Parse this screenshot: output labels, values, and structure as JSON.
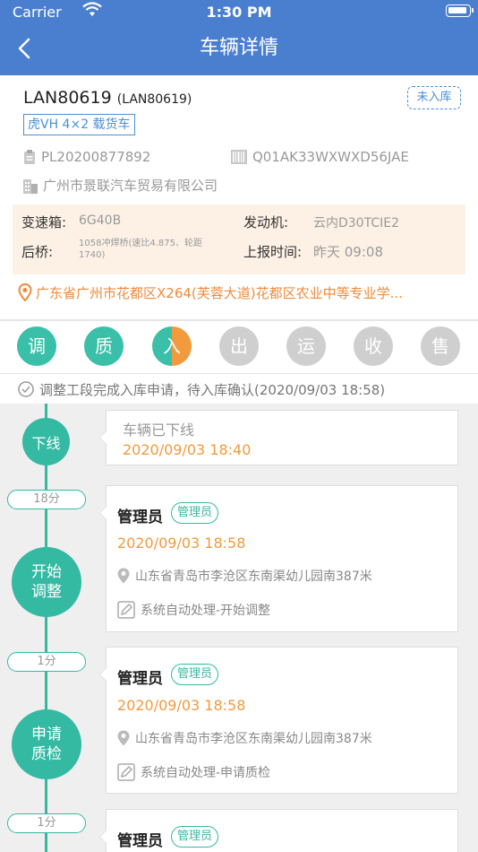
{
  "status_bar": {
    "carrier": "Carrier",
    "time": "1:30 PM"
  },
  "nav": {
    "title": "车辆详情"
  },
  "vehicle": {
    "plate": "LAN80619",
    "plate_sub": "(LAN80619)",
    "status": "未入库",
    "model": "虎VH 4×2 载货车",
    "pl_number": "PL20200877892",
    "vin": "Q01AK33WXWXD56JAE",
    "company": "广州市景联汽车贸易有限公司",
    "specs": {
      "gearbox_label": "变速箱:",
      "gearbox_value": "6G40B",
      "engine_label": "发动机:",
      "engine_value": "云内D30TCIE2",
      "rear_axle_label": "后桥:",
      "rear_axle_value": "1058冲焊桥(速比4.875、轮距1740)",
      "report_time_label": "上报时间:",
      "report_time_value": "昨天 09:08"
    },
    "address": "广东省广州市花都区X264(芙蓉大道)花都区农业中等专业学..."
  },
  "steps": [
    {
      "label": "调",
      "state": "done"
    },
    {
      "label": "质",
      "state": "done"
    },
    {
      "label": "入",
      "state": "half"
    },
    {
      "label": "出",
      "state": "todo"
    },
    {
      "label": "运",
      "state": "todo"
    },
    {
      "label": "收",
      "state": "todo"
    },
    {
      "label": "售",
      "state": "todo"
    }
  ],
  "notice": "调整工段完成入库申请，待入库确认(2020/09/03 18:58)",
  "timeline": {
    "node1": {
      "label": "下线",
      "title": "车辆已下线",
      "time": "2020/09/03 18:40"
    },
    "dur1": "18分",
    "node2": {
      "label": "开始调整",
      "label_line1": "开始",
      "label_line2": "调整",
      "user": "管理员",
      "role": "管理员",
      "time": "2020/09/03 18:58",
      "location": "山东省青岛市李沧区东南渠幼儿园南387米",
      "note": "系统自动处理-开始调整"
    },
    "dur2": "1分",
    "node3": {
      "label_line1": "申请",
      "label_line2": "质检",
      "user": "管理员",
      "role": "管理员",
      "time": "2020/09/03 18:58",
      "location": "山东省青岛市李沧区东南渠幼儿园南387米",
      "note": "系统自动处理-申请质检"
    },
    "dur3": "1分",
    "node4": {
      "user": "管理员",
      "role": "管理员"
    }
  },
  "colors": {
    "header": "#4a7fcf",
    "teal": "#34b9a2",
    "orange": "#f19a3e",
    "spec_bg": "#fdf1e6"
  }
}
